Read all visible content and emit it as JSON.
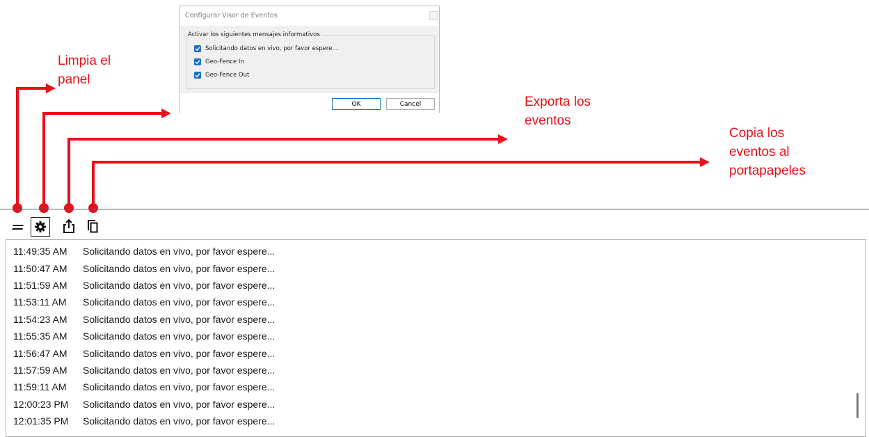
{
  "dialog": {
    "title": "Configurar Visor de Eventos",
    "group_label": "Activar los siguientes mensajes informativos",
    "options": [
      {
        "label": "Solicitando datos en vivo, por favor espere...",
        "checked": true
      },
      {
        "label": "Geo-Fence In",
        "checked": true
      },
      {
        "label": "Geo-Fence Out",
        "checked": true
      }
    ],
    "ok_label": "OK",
    "cancel_label": "Cancel"
  },
  "annotations": {
    "clear": "Limpia el\npanel",
    "export": "Exporta los\neventos",
    "copy": "Copia los\neventos al\nportapapeles",
    "color": "#e8101a"
  },
  "toolbar": {
    "icons": [
      "clear-icon",
      "gear-icon",
      "export-icon",
      "copy-icon"
    ]
  },
  "log": {
    "rows": [
      {
        "time": "11:49:35 AM",
        "message": "Solicitando datos en vivo, por favor espere..."
      },
      {
        "time": "11:50:47 AM",
        "message": "Solicitando datos en vivo, por favor espere..."
      },
      {
        "time": "11:51:59 AM",
        "message": "Solicitando datos en vivo, por favor espere..."
      },
      {
        "time": "11:53:11 AM",
        "message": "Solicitando datos en vivo, por favor espere..."
      },
      {
        "time": "11:54:23 AM",
        "message": "Solicitando datos en vivo, por favor espere..."
      },
      {
        "time": "11:55:35 AM",
        "message": "Solicitando datos en vivo, por favor espere..."
      },
      {
        "time": "11:56:47 AM",
        "message": "Solicitando datos en vivo, por favor espere..."
      },
      {
        "time": "11:57:59 AM",
        "message": "Solicitando datos en vivo, por favor espere..."
      },
      {
        "time": "11:59:11 AM",
        "message": "Solicitando datos en vivo, por favor espere..."
      },
      {
        "time": "12:00:23 PM",
        "message": "Solicitando datos en vivo, por favor espere..."
      },
      {
        "time": "12:01:35 PM",
        "message": "Solicitando datos en vivo, por favor espere..."
      }
    ]
  }
}
